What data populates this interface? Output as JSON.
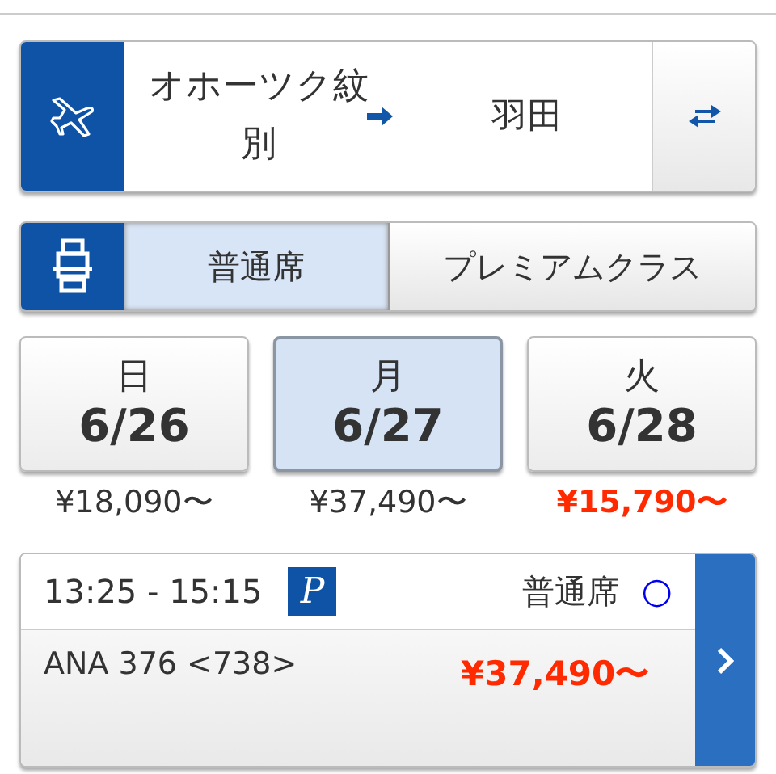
{
  "route": {
    "from": "オホーツク紋別",
    "to": "羽田"
  },
  "seat_classes": [
    {
      "label": "普通席",
      "selected": true
    },
    {
      "label": "プレミアムクラス",
      "selected": false
    }
  ],
  "dates": [
    {
      "weekday": "日",
      "date": "6/26",
      "price": "¥18,090〜",
      "selected": false,
      "lowest": false
    },
    {
      "weekday": "月",
      "date": "6/27",
      "price": "¥37,490〜",
      "selected": true,
      "lowest": false
    },
    {
      "weekday": "火",
      "date": "6/28",
      "price": "¥15,790〜",
      "selected": false,
      "lowest": true
    }
  ],
  "flights": [
    {
      "time": "13:25 - 15:15",
      "badge": "P",
      "seat_class": "普通席",
      "availability": "○",
      "flight": "ANA 376 <738>",
      "price": "¥37,490〜"
    }
  ]
}
